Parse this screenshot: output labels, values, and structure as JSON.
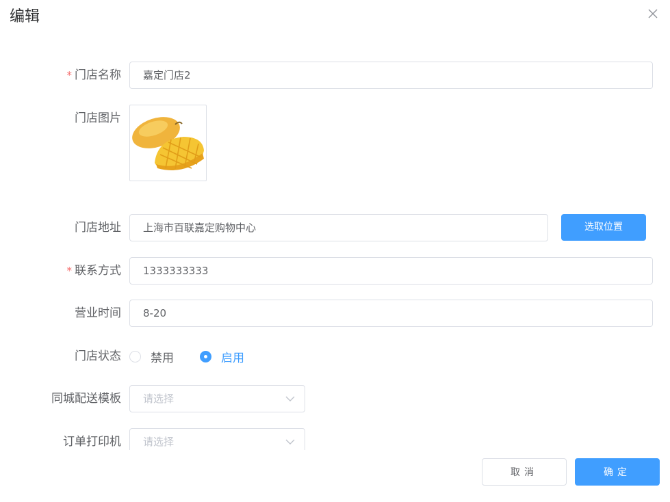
{
  "dialog": {
    "title": "编辑",
    "close_icon": "close-icon"
  },
  "form": {
    "store_name": {
      "label": "门店名称",
      "required_mark": "*",
      "value": "嘉定门店2"
    },
    "store_image": {
      "label": "门店图片",
      "image_icon": "mango-image"
    },
    "store_address": {
      "label": "门店地址",
      "value": "上海市百联嘉定购物中心",
      "pick_button": "选取位置"
    },
    "contact": {
      "label": "联系方式",
      "required_mark": "*",
      "value": "1333333333"
    },
    "business_hours": {
      "label": "营业时间",
      "value": "8-20"
    },
    "store_status": {
      "label": "门店状态",
      "options": [
        {
          "label": "禁用",
          "checked": false
        },
        {
          "label": "启用",
          "checked": true
        }
      ]
    },
    "delivery_template": {
      "label": "同城配送模板",
      "placeholder": "请选择",
      "arrow_icon": "chevron-down-icon"
    },
    "printer": {
      "label": "订单打印机",
      "placeholder": "请选择",
      "arrow_icon": "chevron-down-icon"
    }
  },
  "footer": {
    "cancel_label": "取消",
    "confirm_label": "确定"
  },
  "colors": {
    "primary": "#409eff",
    "required": "#f56c6c",
    "border": "#dcdfe6",
    "placeholder": "#c0c4cc",
    "text": "#606266"
  }
}
